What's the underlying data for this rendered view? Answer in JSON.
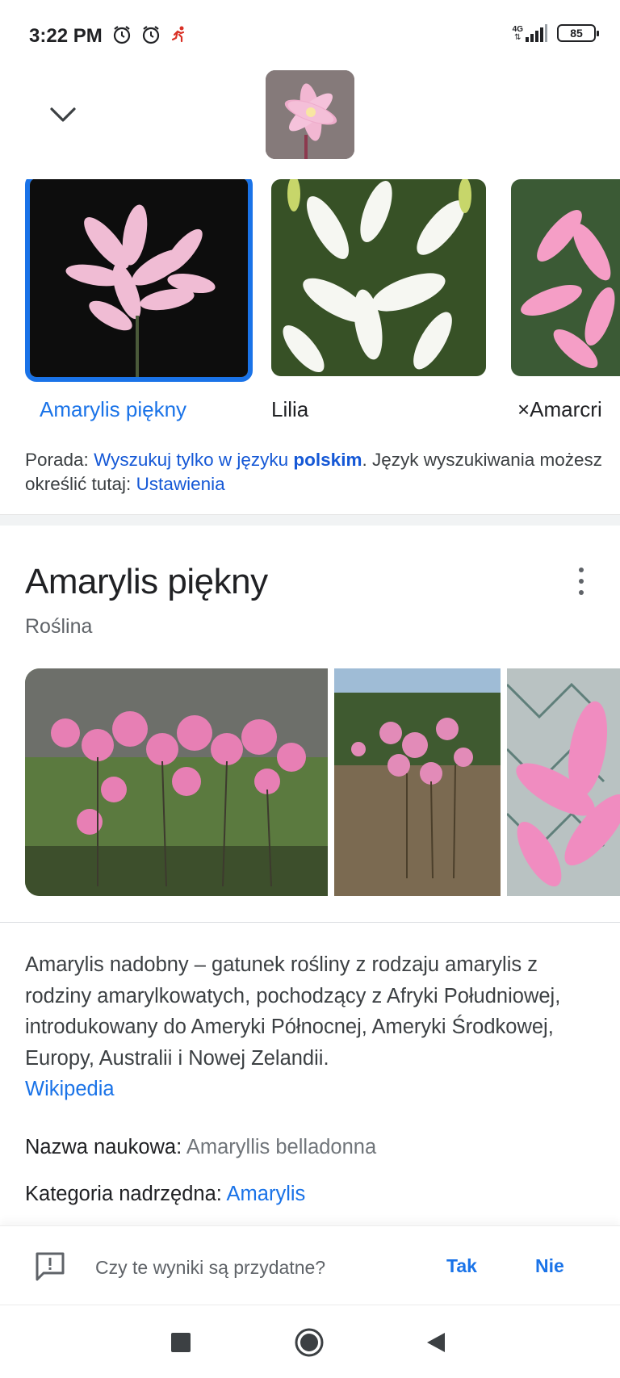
{
  "status_bar": {
    "time": "3:22 PM",
    "network": "4G",
    "battery": "85"
  },
  "query_image_alt": "pink lily flower",
  "carousel": [
    {
      "label": "Amarylis piękny",
      "selected": true
    },
    {
      "label": "Lilia",
      "selected": false
    },
    {
      "label": "×Amarcri",
      "selected": false
    }
  ],
  "tip": {
    "prefix": "Porada: ",
    "link1_a": "Wyszukuj tylko w języku ",
    "link1_b": "polskim",
    "middle": ". Język wyszukiwania możesz określić tutaj: ",
    "link2": "Ustawienia"
  },
  "knowledge_panel": {
    "title": "Amarylis piękny",
    "subtitle": "Roślina",
    "description": "Amarylis nadobny – gatunek rośliny z rodzaju amarylis z rodziny amarylkowatych, pochodzący z Afryki Południowej, introdukowany do Ameryki Północnej, Ameryki Środkowej, Europy, Australii i Nowej Zelandii.",
    "source": "Wikipedia",
    "facts": [
      {
        "label": "Nazwa naukowa: ",
        "value": "Amaryllis belladonna"
      },
      {
        "label": "Kategoria nadrzędna: ",
        "value": "Amarylis"
      }
    ]
  },
  "feedback": {
    "question": "Czy te wyniki są przydatne?",
    "yes": "Tak",
    "no": "Nie"
  },
  "colors": {
    "accent": "#1a73e8",
    "link": "#1558d6",
    "text": "#202124",
    "secondary_text": "#5f6368"
  }
}
